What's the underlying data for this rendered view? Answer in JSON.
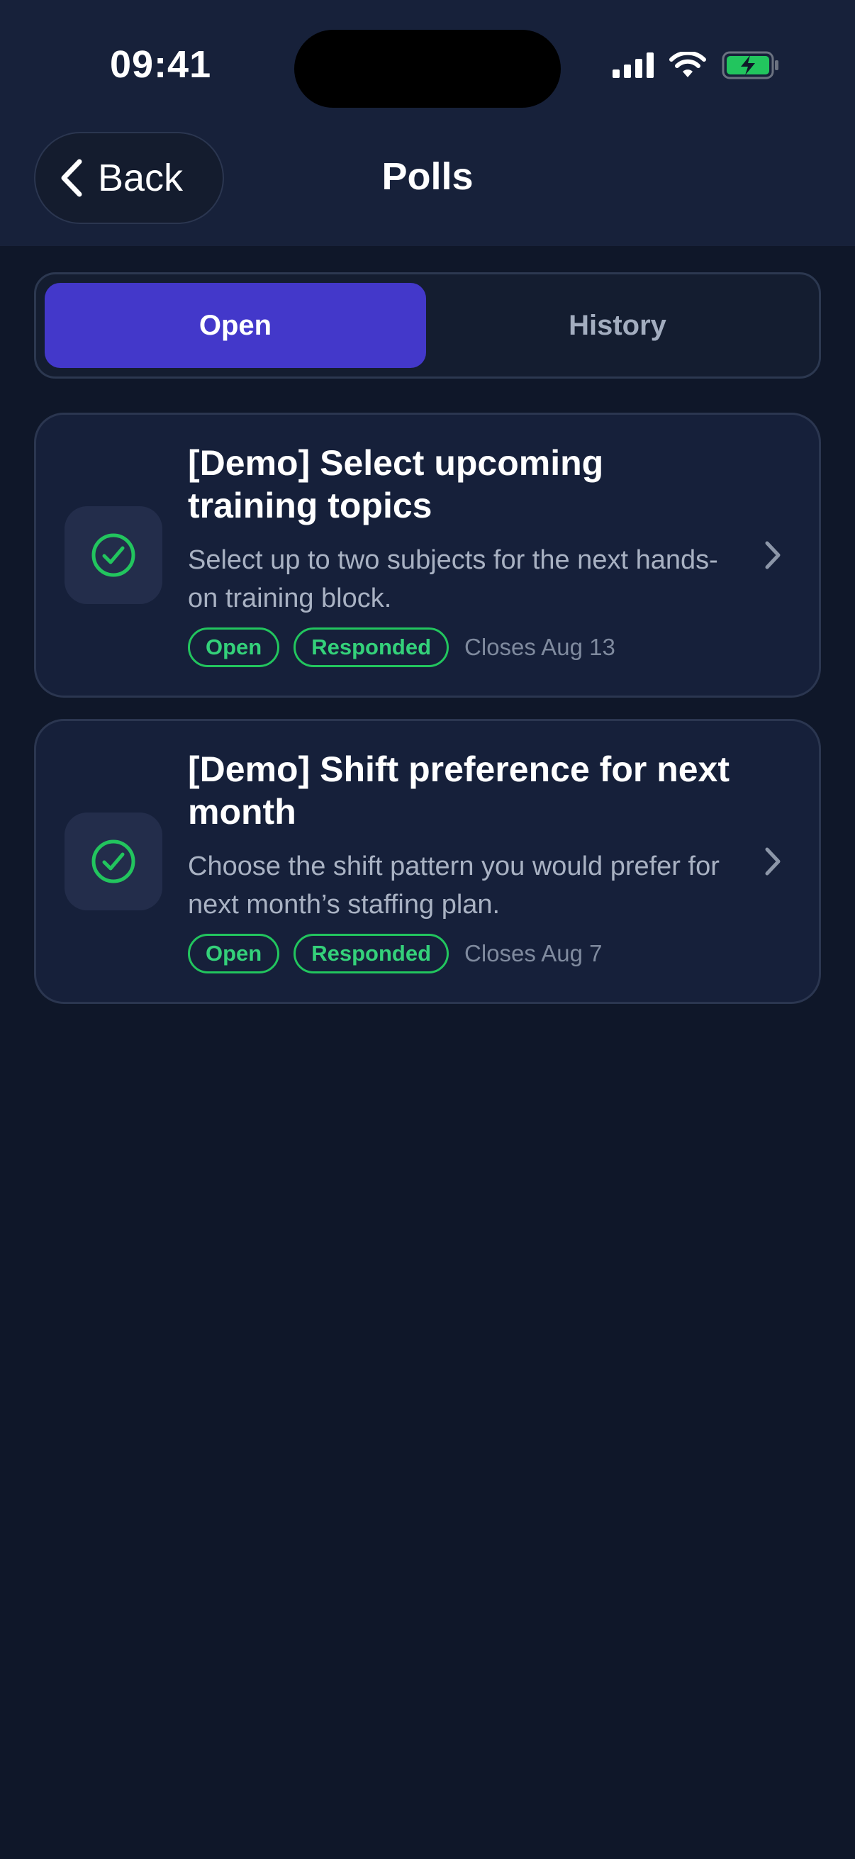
{
  "status_bar": {
    "time": "09:41",
    "icons": [
      "signal-icon",
      "wifi-icon",
      "battery-charging-icon"
    ]
  },
  "header": {
    "back_label": "Back",
    "title": "Polls"
  },
  "tabs": [
    {
      "label": "Open",
      "selected": true
    },
    {
      "label": "History",
      "selected": false
    }
  ],
  "polls": [
    {
      "title": "[Demo] Select upcoming training topics",
      "description": "Select up to two subjects for the next hands-on training block.",
      "badges": [
        "Open",
        "Responded"
      ],
      "closes": "Closes Aug 13",
      "icon": "check-circle-icon"
    },
    {
      "title": "[Demo] Shift preference for next month",
      "description": "Choose the shift pattern you would prefer for next month’s staffing plan.",
      "badges": [
        "Open",
        "Responded"
      ],
      "closes": "Closes Aug 7",
      "icon": "check-circle-icon"
    }
  ],
  "colors": {
    "background": "#0f1729",
    "header": "#17213a",
    "accent": "#4338ca",
    "success": "#22c55e",
    "muted_text": "#a9b2c3"
  }
}
